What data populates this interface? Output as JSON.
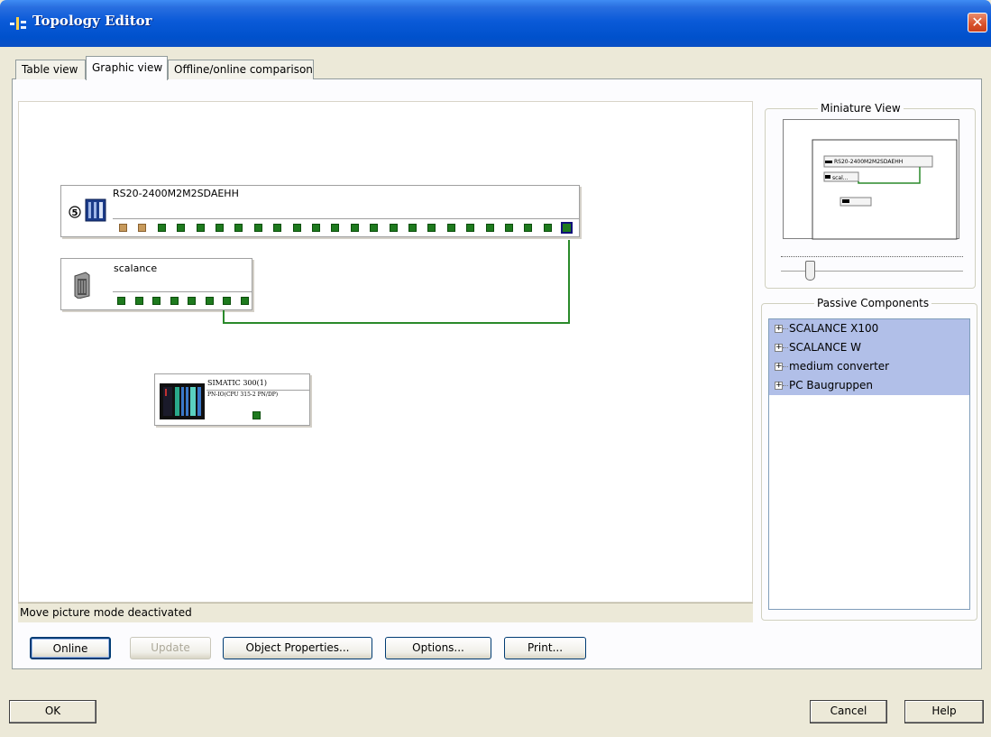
{
  "window": {
    "title": "Topology Editor",
    "close_label": "✕"
  },
  "tabs": [
    {
      "label": "Table view"
    },
    {
      "label": "Graphic view"
    },
    {
      "label": "Offline/online comparison"
    }
  ],
  "canvas": {
    "devices": {
      "rs20": {
        "name": "RS20-2400M2M2SDAEHH",
        "port_count": 24,
        "orange_ports": 2
      },
      "scalance": {
        "name": "scalance",
        "port_count": 8
      },
      "simatic": {
        "name": "SIMATIC 300(1)",
        "subtitle": "PN-IO(CPU 315-2 PN/DP)"
      }
    },
    "status": "Move picture mode deactivated"
  },
  "miniature_view": {
    "title": "Miniature View",
    "labels": {
      "rs20": "RS20-2400M2M2SDAEHH",
      "scalance": "scal..."
    }
  },
  "passive_components": {
    "title": "Passive Components",
    "items": [
      {
        "label": "SCALANCE X100"
      },
      {
        "label": "SCALANCE W"
      },
      {
        "label": "medium converter"
      },
      {
        "label": "PC Baugruppen"
      }
    ]
  },
  "buttons": {
    "online": "Online",
    "update": "Update",
    "object_properties": "Object Properties...",
    "options": "Options...",
    "print": "Print...",
    "ok": "OK",
    "cancel": "Cancel",
    "help": "Help"
  },
  "colors": {
    "port_green": "#1e7a1e",
    "port_orange": "#c79a5c",
    "link_green": "#2a8a2a",
    "selection": "#b1bfe8"
  }
}
